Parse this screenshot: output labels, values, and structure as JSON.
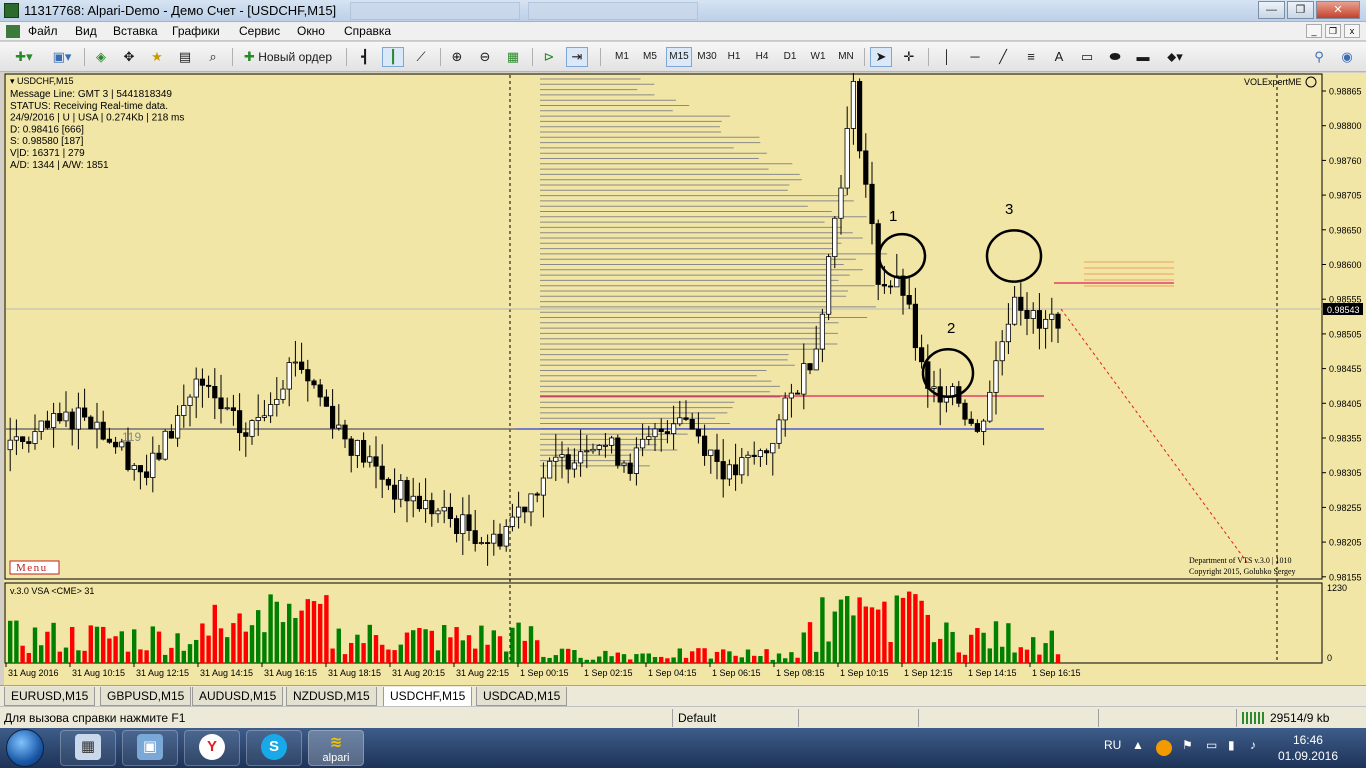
{
  "window": {
    "title": "11317768: Alpari-Demo - Демо Счет - [USDCHF,M15]",
    "minimize": "—",
    "restore": "❐",
    "close": "✕"
  },
  "menu": {
    "items": [
      "Файл",
      "Вид",
      "Вставка",
      "Графики",
      "Сервис",
      "Окно",
      "Справка"
    ],
    "mdi_buttons": [
      "_",
      "❐",
      "x"
    ]
  },
  "toolbar": {
    "new_order": "Новый ордер",
    "timeframes": [
      "M1",
      "M5",
      "M15",
      "M30",
      "H1",
      "H4",
      "D1",
      "W1",
      "MN"
    ],
    "selected_timeframe": "M15"
  },
  "chart": {
    "symbol_label": "USDCHF,M15",
    "info_lines": [
      "Message Line: GMT 3 | 5441818349",
      "STATUS:  Receiving Real-time data.",
      "24/9/2016 | U | USA | 0.274Kb | 218 ms",
      "D: 0.98416  [666]",
      "S: 0.98580  [187]",
      "V|D: 16371 | 279",
      "A/D: 1344 | A/W: 1851"
    ],
    "expert_label": "VOLExpertME",
    "menu_button": "Menu",
    "level_label": "119",
    "credits": [
      "Department of VTS  v.3.0 | 1010",
      "Copyright 2015, Golubko Sergey"
    ],
    "price_axis": [
      "0.98865",
      "0.98800",
      "0.98760",
      "0.98705",
      "0.98650",
      "0.98600",
      "0.98555",
      "0.98505",
      "0.98455",
      "0.98405",
      "0.98355",
      "0.98305",
      "0.98255",
      "0.98205",
      "0.98155"
    ],
    "current_price": "0.98543",
    "time_axis": [
      "31 Aug 2016",
      "31 Aug 10:15",
      "31 Aug 12:15",
      "31 Aug 14:15",
      "31 Aug 16:15",
      "31 Aug 18:15",
      "31 Aug 20:15",
      "31 Aug 22:15",
      "1 Sep 00:15",
      "1 Sep 02:15",
      "1 Sep 04:15",
      "1 Sep 06:15",
      "1 Sep 08:15",
      "1 Sep 10:15",
      "1 Sep 12:15",
      "1 Sep 14:15",
      "1 Sep 16:15"
    ],
    "annotations": [
      "1",
      "2",
      "3"
    ],
    "sub_window_label": "v.3.0 VSA <CME> 31",
    "sub_axis_top": "1230",
    "sub_axis_bottom": "0",
    "colors": {
      "background": "#f1e6a6",
      "bull": "#ffffff",
      "bear": "#000000",
      "vol_green": "#008000",
      "vol_red": "#ff0000",
      "level_blue": "#2f3fd9",
      "level_red": "#e0205a"
    }
  },
  "tabs": [
    "EURUSD,M15",
    "GBPUSD,M15",
    "AUDUSD,M15",
    "NZDUSD,M15",
    "USDCHF,M15",
    "USDCAD,M15"
  ],
  "active_tab": "USDCHF,M15",
  "status": {
    "help": "Для вызова справки нажмите F1",
    "profile": "Default",
    "traffic": "29514/9 kb"
  },
  "taskbar": {
    "lang": "RU",
    "time": "16:46",
    "date": "01.09.2016",
    "alpari_label": "alpari"
  }
}
